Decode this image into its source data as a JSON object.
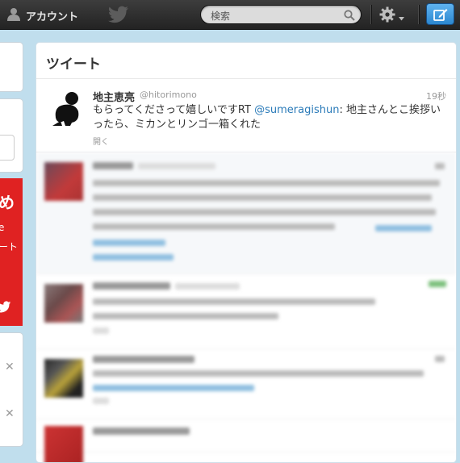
{
  "topbar": {
    "account_label": "アカウント",
    "search_placeholder": "検索",
    "icons": [
      "person-icon",
      "twitter-bird-icon",
      "search-icon",
      "gear-icon",
      "chevron-down-icon",
      "compose-icon"
    ]
  },
  "sidebar": {
    "promo_big": "め",
    "promo_line1": "e",
    "promo_line2": "ート"
  },
  "panel": {
    "title": "ツイート",
    "tweet": {
      "name": "地主恵亮",
      "handle": "@hitorimono",
      "time": "19秒",
      "text_before": "もらってくださって嬉しいですRT ",
      "mention": "@sumeragishun",
      "text_after": ": 地主さんとこ挨拶いったら、ミカンとリンゴ一箱くれた",
      "open_label": "開く"
    }
  },
  "colors": {
    "background": "#c0deed",
    "topbar": "#2a2a2a",
    "link": "#2b7bb9",
    "compose": "#3b95df",
    "promo": "#e02222"
  }
}
